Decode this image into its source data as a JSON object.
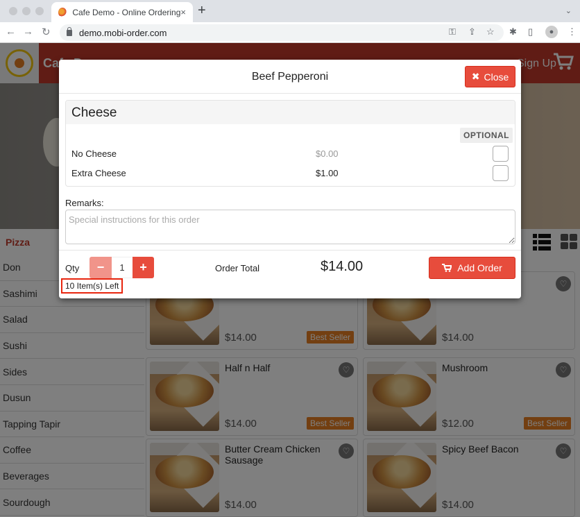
{
  "browser": {
    "tab_title": "Cafe Demo - Online Ordering",
    "url": "demo.mobi-order.com",
    "new_tab": "+",
    "tab_close": "×"
  },
  "navbar": {
    "brand": "Cafe Demo",
    "signup": "Sign Up",
    "brand_color": "#c0392b"
  },
  "category": {
    "current": "Pizza"
  },
  "sidebar": {
    "items": [
      "Don",
      "Sashimi",
      "Salad",
      "Sushi",
      "Sides",
      "Dusun",
      "Tapping Tapir",
      "Coffee",
      "Beverages",
      "Sourdough"
    ]
  },
  "products": [
    {
      "name": "",
      "price": "$14.00",
      "badge": "Best Seller"
    },
    {
      "name": "",
      "price": "$14.00",
      "badge": ""
    },
    {
      "name": "Half n Half",
      "price": "$14.00",
      "badge": "Best Seller"
    },
    {
      "name": "Mushroom",
      "price": "$12.00",
      "badge": "Best Seller"
    },
    {
      "name": "Butter Cream Chicken Sausage",
      "price": "$14.00",
      "badge": ""
    },
    {
      "name": "Spicy Beef Bacon",
      "price": "$14.00",
      "badge": ""
    }
  ],
  "modal": {
    "title": "Beef Pepperoni",
    "close_label": "Close",
    "option_group": {
      "title": "Cheese",
      "tag": "OPTIONAL",
      "options": [
        {
          "name": "No Cheese",
          "price": "$0.00",
          "checked": false
        },
        {
          "name": "Extra Cheese",
          "price": "$1.00",
          "checked": false
        }
      ]
    },
    "remarks_label": "Remarks:",
    "remarks_placeholder": "Special instructions for this order",
    "qty_label": "Qty",
    "qty_value": "1",
    "minus": "−",
    "plus": "+",
    "items_left": "10 Item(s) Left",
    "order_total_label": "Order Total",
    "order_total": "$14.00",
    "add_label": "Add Order",
    "accent": "#e74c3c"
  }
}
